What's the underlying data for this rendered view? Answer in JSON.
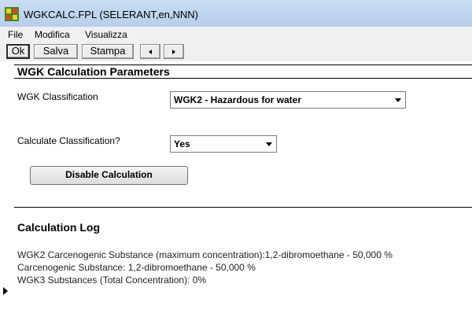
{
  "window": {
    "title": "WGKCALC.FPL (SELERANT,en,NNN)"
  },
  "menu": [
    "File",
    "Modifica",
    "Visualizza"
  ],
  "toolbar": {
    "ok": "Ok",
    "save": "Salva",
    "print": "Stampa"
  },
  "params": {
    "heading": "WGK Calculation Parameters",
    "classification_label": "WGK Classification",
    "classification_value": "WGK2 - Hazardous for water",
    "calculate_label": "Calculate Classification?",
    "calculate_value": "Yes",
    "disable_button": "Disable Calculation"
  },
  "log": {
    "heading": "Calculation Log",
    "lines": [
      "WGK2 Carcenogenic Substance (maximum concentration):1,2-dibromoethane - 50,000 %",
      "Carcenogenic Substance: 1,2-dibromoethane - 50,000 %",
      "WGK3 Substances (Total Concentration): 0%"
    ]
  },
  "icons": [
    "app-icon",
    "nav-prev-icon",
    "nav-next-icon",
    "dropdown-arrow-icon",
    "row-pointer-icon"
  ]
}
